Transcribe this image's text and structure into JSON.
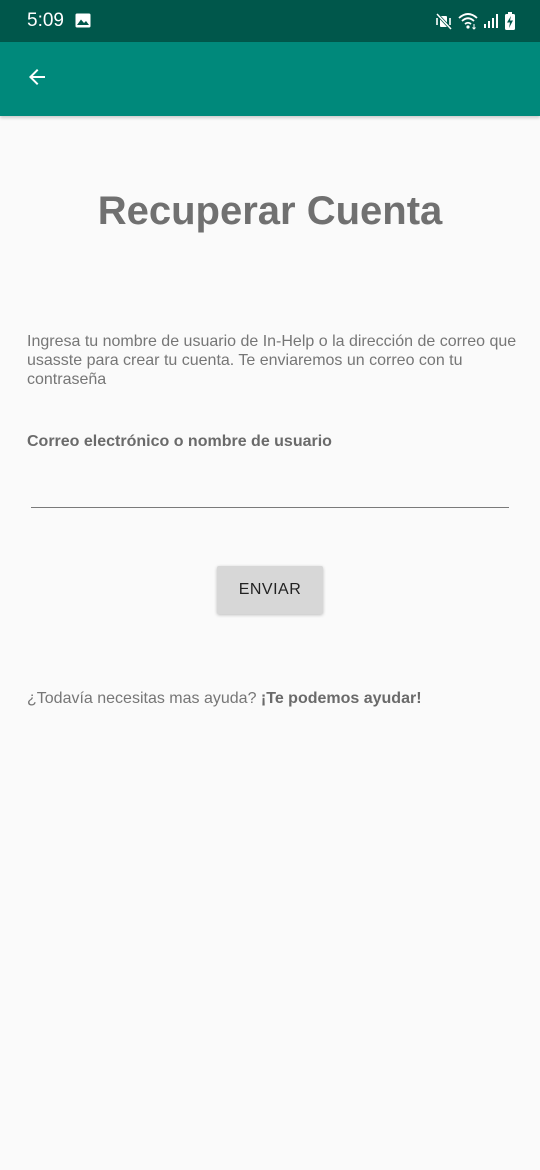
{
  "status_bar": {
    "time": "5:09",
    "icons": [
      "image-icon",
      "mute-vibrate-icon",
      "wifi-icon",
      "signal-icon",
      "battery-charging-icon"
    ],
    "color": "#00574b"
  },
  "app_bar": {
    "back_icon": "arrow-back-icon",
    "color": "#00897b"
  },
  "page": {
    "title": "Recuperar Cuenta",
    "instructions": "Ingresa tu nombre de usuario de In-Help o la dirección de correo que usasste para crear tu cuenta. Te enviaremos un correo con tu contraseña",
    "field_label": "Correo electrónico o nombre de usuario",
    "field_value": "",
    "field_placeholder": "",
    "send_label": "ENVIAR",
    "help_text": "¿Todavía necesitas mas ayuda? ",
    "help_link": "¡Te podemos ayudar!"
  }
}
